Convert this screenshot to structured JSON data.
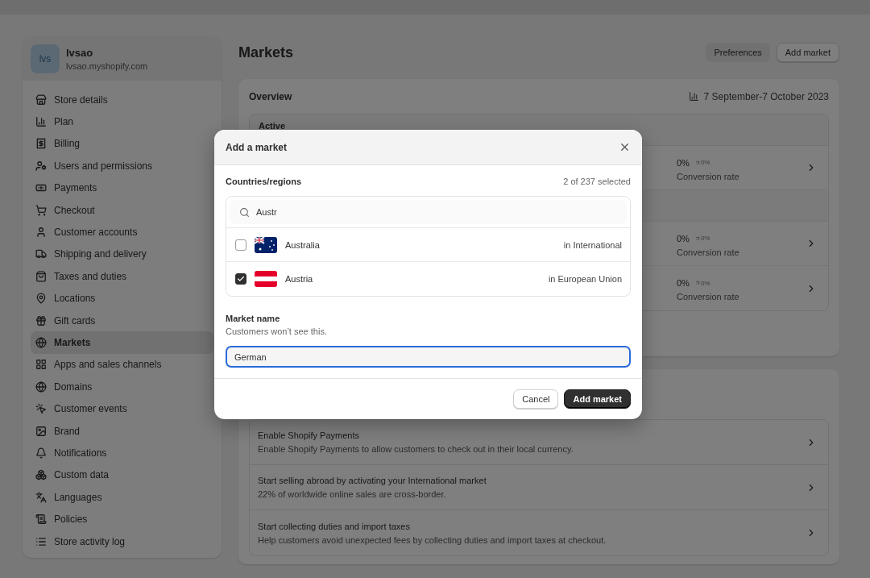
{
  "store": {
    "initials": "lvs",
    "name": "lvsao",
    "domain": "lvsao.myshopify.com"
  },
  "sidebar": {
    "items": [
      {
        "label": "Store details",
        "selected": false
      },
      {
        "label": "Plan",
        "selected": false
      },
      {
        "label": "Billing",
        "selected": false
      },
      {
        "label": "Users and permissions",
        "selected": false
      },
      {
        "label": "Payments",
        "selected": false
      },
      {
        "label": "Checkout",
        "selected": false
      },
      {
        "label": "Customer accounts",
        "selected": false
      },
      {
        "label": "Shipping and delivery",
        "selected": false
      },
      {
        "label": "Taxes and duties",
        "selected": false
      },
      {
        "label": "Locations",
        "selected": false
      },
      {
        "label": "Gift cards",
        "selected": false
      },
      {
        "label": "Markets",
        "selected": true
      },
      {
        "label": "Apps and sales channels",
        "selected": false
      },
      {
        "label": "Domains",
        "selected": false
      },
      {
        "label": "Customer events",
        "selected": false
      },
      {
        "label": "Brand",
        "selected": false
      },
      {
        "label": "Notifications",
        "selected": false
      },
      {
        "label": "Custom data",
        "selected": false
      },
      {
        "label": "Languages",
        "selected": false
      },
      {
        "label": "Policies",
        "selected": false
      },
      {
        "label": "Store activity log",
        "selected": false
      }
    ]
  },
  "page": {
    "title": "Markets",
    "actions": [
      {
        "label": "Preferences",
        "kind": "secondary"
      },
      {
        "label": "Add market",
        "kind": "outline"
      }
    ]
  },
  "overview": {
    "title": "Overview",
    "date_range": "7 September-7 October 2023",
    "group_label": "Active",
    "rows": [
      {
        "value": "0%",
        "change": "0%",
        "label": "Conversion rate",
        "group_start": false
      },
      {
        "value": "0%",
        "change": "0%",
        "label": "Conversion rate",
        "group_start": true
      },
      {
        "value": "0%",
        "change": "0%",
        "label": "Conversion rate",
        "group_start": false
      }
    ]
  },
  "suggestions": [
    {
      "title": "Enable Shopify Payments",
      "description": "Enable Shopify Payments to allow customers to check out in their local currency."
    },
    {
      "title": "Start selling abroad by activating your International market",
      "description": "22% of worldwide online sales are cross-border."
    },
    {
      "title": "Start collecting duties and import taxes",
      "description": "Help customers avoid unexpected fees by collecting duties and import taxes at checkout."
    }
  ],
  "dialog": {
    "title": "Add a market",
    "section_label": "Countries/regions",
    "selection_count": "2 of 237 selected",
    "search": {
      "value": "Austr"
    },
    "countries": [
      {
        "name": "Australia",
        "region": "in International",
        "checked": false,
        "kind": "australia"
      },
      {
        "name": "Austria",
        "region": "in European Union",
        "checked": true,
        "kind": "austria"
      }
    ],
    "name_field": {
      "label": "Market name",
      "help": "Customers won’t see this.",
      "value": "German"
    },
    "buttons": [
      {
        "label": "Cancel",
        "kind": "secondary"
      },
      {
        "label": "Add market",
        "kind": "primary"
      }
    ]
  }
}
